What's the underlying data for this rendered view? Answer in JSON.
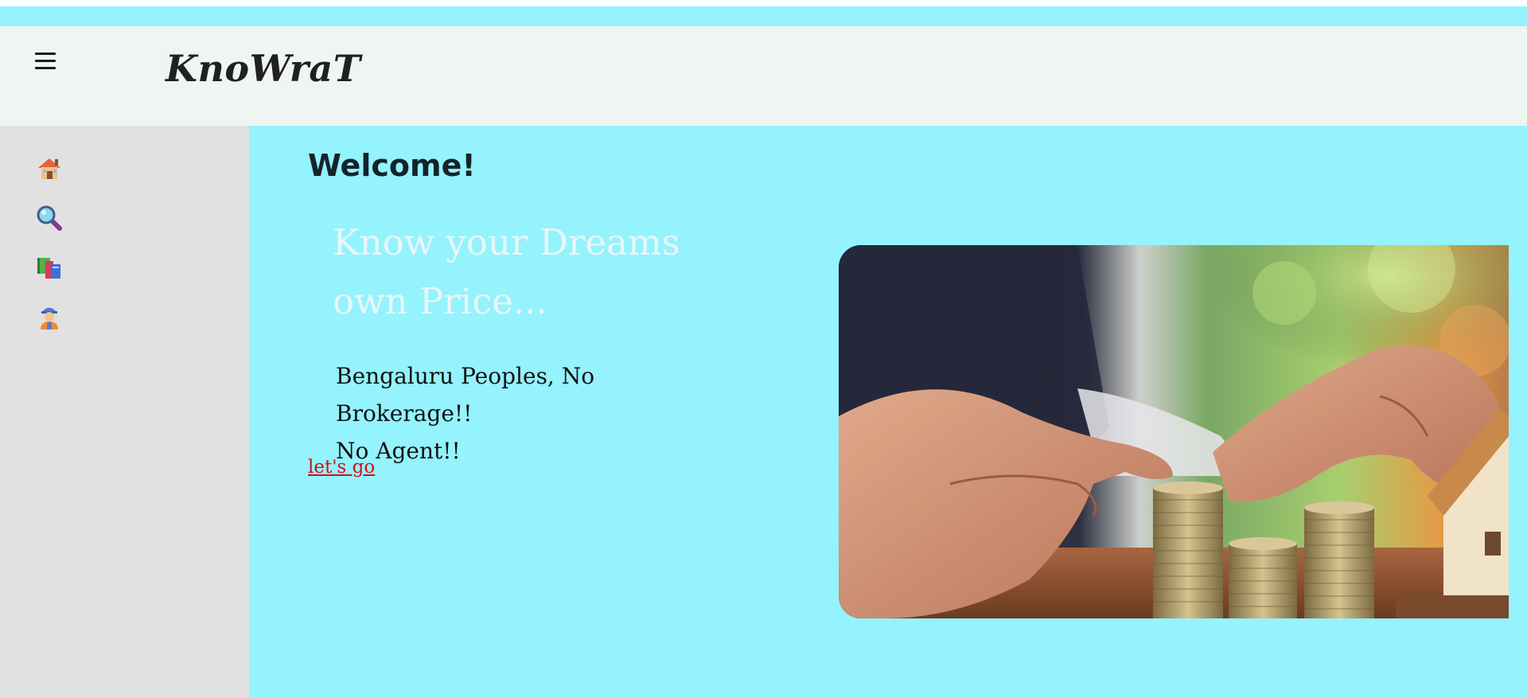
{
  "header": {
    "menu_icon": "hamburger-menu-icon",
    "brand": "KnoWraT"
  },
  "sidebar": {
    "items": [
      {
        "icon": "house-icon"
      },
      {
        "icon": "magnifier-icon"
      },
      {
        "icon": "books-icon"
      },
      {
        "icon": "worker-icon"
      }
    ]
  },
  "main": {
    "welcome": "Welcome!",
    "hero_line1": "Know your Dreams",
    "hero_line2": "own Price...",
    "tagline_line1": "Bengaluru Peoples, No Brokerage!!",
    "tagline_line2": "No Agent!!",
    "cta_label": "let's go"
  },
  "colors": {
    "accent_cyan": "#94f3fd",
    "header_bg": "#eff5f1",
    "sidebar_bg": "#e1e1e1",
    "link_red": "#d20f16"
  }
}
